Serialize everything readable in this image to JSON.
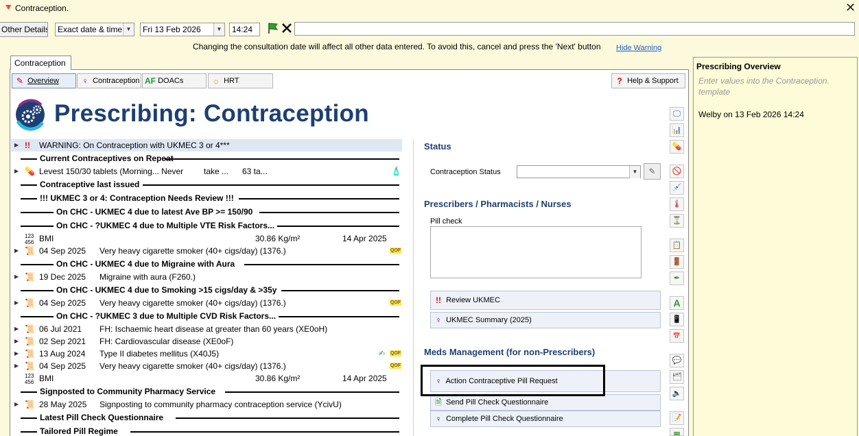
{
  "window": {
    "title": "Contraception.",
    "close_glyph": "✕"
  },
  "toolbar": {
    "other_details": "Other Details...",
    "date_mode": "Exact date & time",
    "date": "Fri 13 Feb 2026",
    "time": "14:24",
    "confirm_icon": "green-flag-icon",
    "cancel_icon": "cross-icon",
    "free_text_value": ""
  },
  "warning": {
    "text": "Changing the consultation date will affect all other data entered. To avoid this, cancel and press the 'Next' button",
    "hide_link": "Hide Warning"
  },
  "main_tab": "Contraception",
  "subtabs": [
    {
      "label": "Overview",
      "icon": "pill-pen-icon"
    },
    {
      "label": "Contraception",
      "icon": "female-symbol-icon"
    },
    {
      "label": "DOACs",
      "icon_text": "AF"
    },
    {
      "label": "HRT",
      "icon": "sun-icon"
    }
  ],
  "help_button": "Help & Support",
  "page_title": "Prescribing: Contraception",
  "list": {
    "warning_row": "WARNING: On Contraception with UKMEC 3 or 4***",
    "header_repeat": "Current Contraceptives on Repeat",
    "repeat_row": {
      "name": "Levest 150/30 tablets (Morning... Never",
      "dose": "take ...",
      "qty": "63 ta..."
    },
    "header_last_issued": "Contraceptive last issued",
    "header_review": "!!! UKMEC 3 or 4: Contraception Needs Review !!!",
    "sub_bp": "On CHC - UKMEC 4 due to latest Ave BP >= 150/90",
    "sub_vte": "On CHC - ?UKMEC 4 due to Multiple VTE Risk Factors...",
    "bmi1": {
      "label": "BMI",
      "value": "30.86 Kg/m²",
      "date": "14 Apr 2025"
    },
    "smoker1": {
      "date": "04 Sep 2025",
      "desc": "Very heavy cigarette smoker (40+ cigs/day) (1376.)",
      "badge": "QOF"
    },
    "sub_migraine": "On CHC - UKMEC 4 due to Migraine with Aura",
    "migraine": {
      "date": "19 Dec 2025",
      "desc": "Migraine with aura (F260.)"
    },
    "sub_smoking": "On CHC - UKMEC 4 due to Smoking >15 cigs/day & >35y",
    "smoker2": {
      "date": "04 Sep 2025",
      "desc": "Very heavy cigarette smoker (40+ cigs/day) (1376.)",
      "badge": "QOF"
    },
    "sub_cvd": "On CHC - ?UKMEC 3 due to Multiple CVD Risk Factors...",
    "fh_ihd": {
      "date": "06 Jul 2021",
      "desc": "FH: Ischaemic heart disease at greater than 60 years (XE0oH)"
    },
    "fh_cvd": {
      "date": "02 Sep 2021",
      "desc": "FH: Cardiovascular disease (XE0oF)"
    },
    "diabetes": {
      "date": "13 Aug 2024",
      "desc": "Type II diabetes mellitus (X40J5)",
      "badge": "QOF"
    },
    "smoker3": {
      "date": "04 Sep 2025",
      "desc": "Very heavy cigarette smoker (40+ cigs/day) (1376.)",
      "badge": "QOF"
    },
    "bmi2": {
      "label": "BMI",
      "value": "30.86 Kg/m²",
      "date": "14 Apr 2025"
    },
    "header_signposted": "Signposted to Community Pharmacy Service",
    "signpost": {
      "date": "28 May 2025",
      "desc": "Signposting to community pharmacy contraception service (YcivU)"
    },
    "header_pill_check": "Latest Pill Check Questionnaire",
    "header_tailored": "Tailored Pill Regime"
  },
  "status": {
    "title": "Status",
    "label": "Contraception Status",
    "value": ""
  },
  "prescribers": {
    "title": "Prescribers / Pharmacists / Nurses",
    "pill_check_label": "Pill check",
    "pill_check_value": "",
    "review_button": "Review UKMEC",
    "summary_button": "UKMEC Summary (2025)"
  },
  "meds": {
    "title": "Meds Management (for non-Prescribers)",
    "action_button": "Action Contraceptive Pill Request",
    "send_button": "Send Pill Check Questionnaire",
    "complete_button": "Complete Pill Check Questionnaire"
  },
  "overview": {
    "title": "Prescribing Overview",
    "hint": "Enter values into the Contraception. template",
    "author_line": "Welby on 13 Feb 2026 14:24"
  },
  "colors": {
    "title_blue": "#1d3f73",
    "panel_bg": "#fcf9dc",
    "warning_red": "#d01010",
    "qof_yellow": "#ffe45c"
  }
}
